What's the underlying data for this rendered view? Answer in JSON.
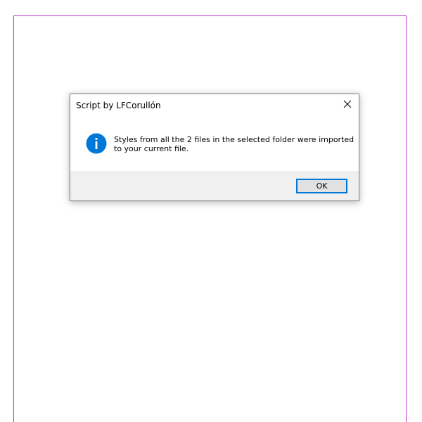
{
  "dialog": {
    "title": "Script by LFCorullón",
    "message_line1": "Styles from all the 2 files in the selected folder were imported",
    "message_line2": "to your current file.",
    "ok_label": "OK",
    "icon": "info-icon"
  },
  "colors": {
    "page_border": "#c030d0",
    "info_icon": "#0078d7",
    "button_focus_border": "#0078d7",
    "footer_bg": "#f0f0f0"
  }
}
